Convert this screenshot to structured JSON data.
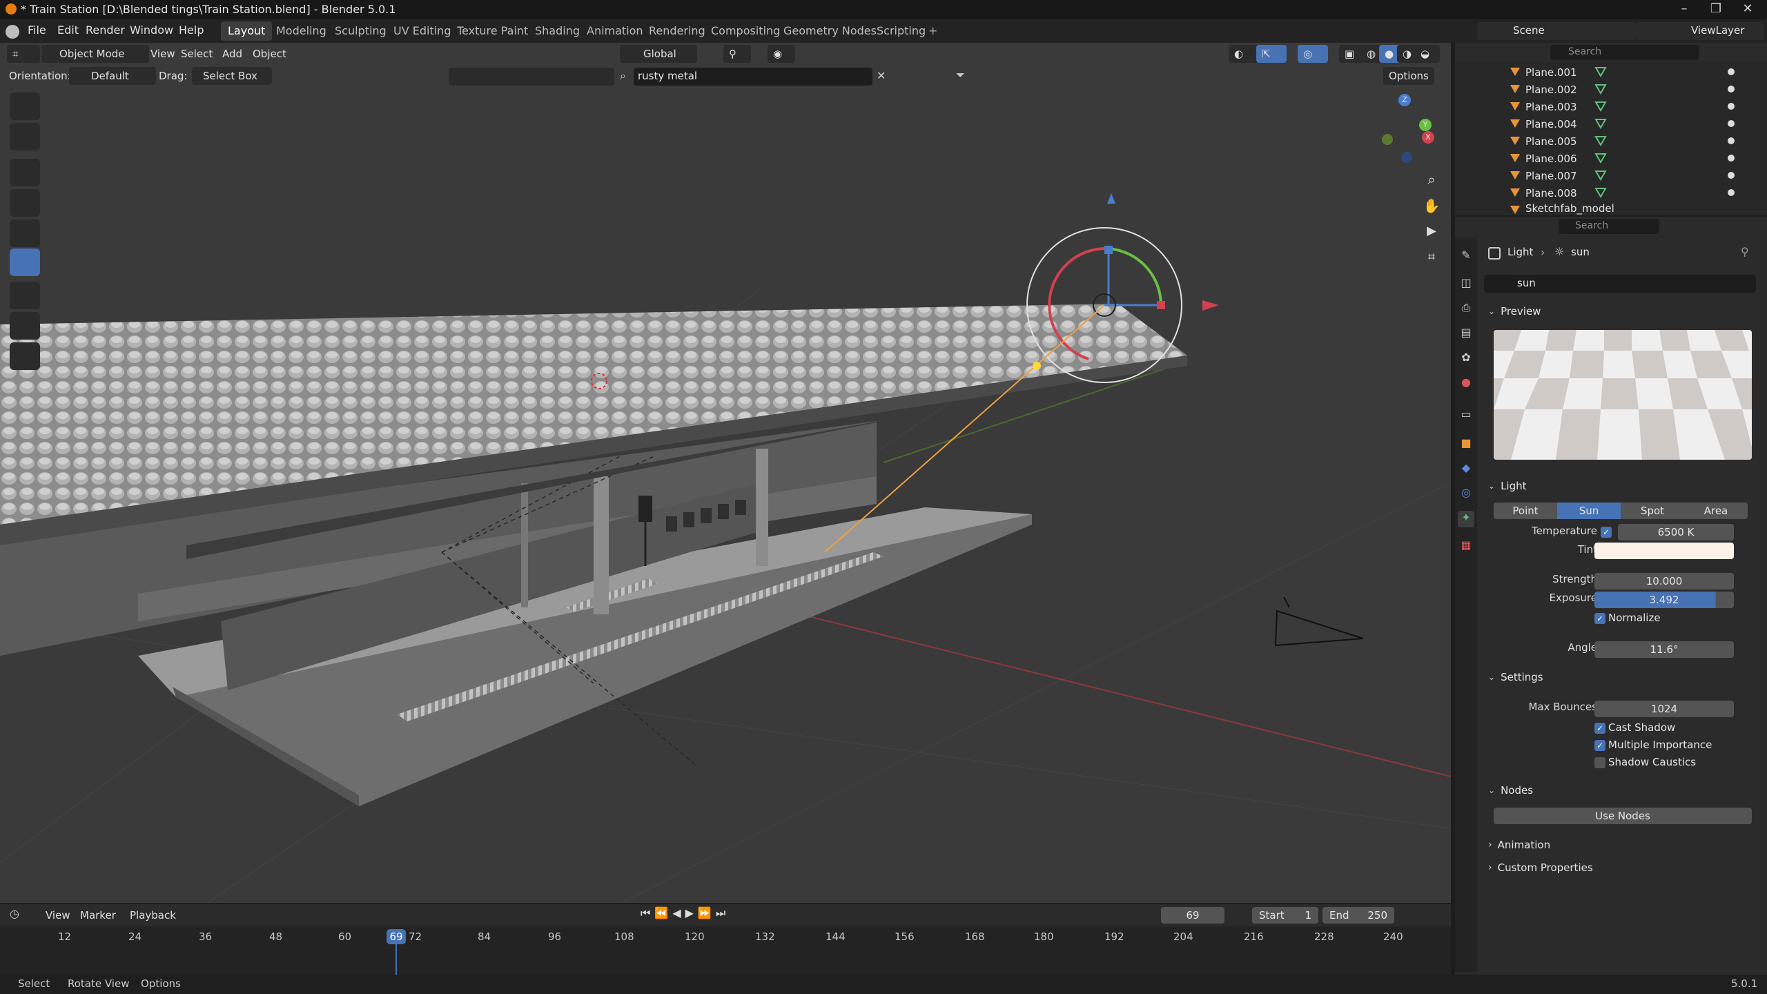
{
  "window": {
    "title": "* Train Station [D:\\Blended tings\\Train Station.blend] - Blender 5.0.1"
  },
  "menu": [
    "File",
    "Edit",
    "Render",
    "Window",
    "Help"
  ],
  "workspaces": [
    "Layout",
    "Modeling",
    "Sculpting",
    "UV Editing",
    "Texture Paint",
    "Shading",
    "Animation",
    "Rendering",
    "Compositing",
    "Geometry Nodes",
    "Scripting"
  ],
  "active_workspace": "Layout",
  "scene": {
    "label": "Scene",
    "view_layer": "ViewLayer"
  },
  "viewport_header": {
    "mode": "Object Mode",
    "menus": [
      "View",
      "Select",
      "Add",
      "Object"
    ],
    "transform_orientation": "Global",
    "orientation_label": "Orientation:",
    "orientation_value": "Default",
    "drag_label": "Drag:",
    "drag_value": "Select Box",
    "search_value": "rusty metal",
    "options": "Options"
  },
  "outliner": {
    "search_placeholder": "Search",
    "items": [
      "Plane.001",
      "Plane.002",
      "Plane.003",
      "Plane.004",
      "Plane.005",
      "Plane.006",
      "Plane.007",
      "Plane.008",
      "Sketchfab_model"
    ]
  },
  "properties": {
    "search_placeholder": "Search",
    "breadcrumb": {
      "object": "Light",
      "data": "sun"
    },
    "datablock_name": "sun",
    "preview_title": "Preview",
    "light_title": "Light",
    "light_types": [
      "Point",
      "Sun",
      "Spot",
      "Area"
    ],
    "active_light_type": "Sun",
    "temperature_label": "Temperature",
    "temperature_value": "6500 K",
    "tint_label": "Tint",
    "tint_color": "#fbf1e6",
    "strength_label": "Strength",
    "strength_value": "10.000",
    "exposure_label": "Exposure",
    "exposure_value": "3.492",
    "normalize_label": "Normalize",
    "angle_label": "Angle",
    "angle_value": "11.6°",
    "settings_title": "Settings",
    "max_bounces_label": "Max Bounces",
    "max_bounces_value": "1024",
    "cast_shadow_label": "Cast Shadow",
    "multiple_importance_label": "Multiple Importance",
    "shadow_caustics_label": "Shadow Caustics",
    "nodes_title": "Nodes",
    "use_nodes_label": "Use Nodes",
    "animation_title": "Animation",
    "custom_props_title": "Custom Properties"
  },
  "timeline": {
    "menus": [
      "View",
      "Marker",
      "Playback"
    ],
    "current_frame": "69",
    "start_label": "Start",
    "start_value": "1",
    "end_label": "End",
    "end_value": "250",
    "ticks": [
      "12",
      "24",
      "36",
      "48",
      "60",
      "72",
      "84",
      "96",
      "108",
      "120",
      "132",
      "144",
      "156",
      "168",
      "180",
      "192",
      "204",
      "216",
      "228",
      "240"
    ],
    "playhead_label": "69"
  },
  "status": {
    "select": "Select",
    "rotate": "Rotate View",
    "options": "Options",
    "version": "5.0.1"
  },
  "colors": {
    "accent": "#4772b3",
    "viewport_bg": "#3a3a3a",
    "panel_bg": "#2b2b2b"
  }
}
